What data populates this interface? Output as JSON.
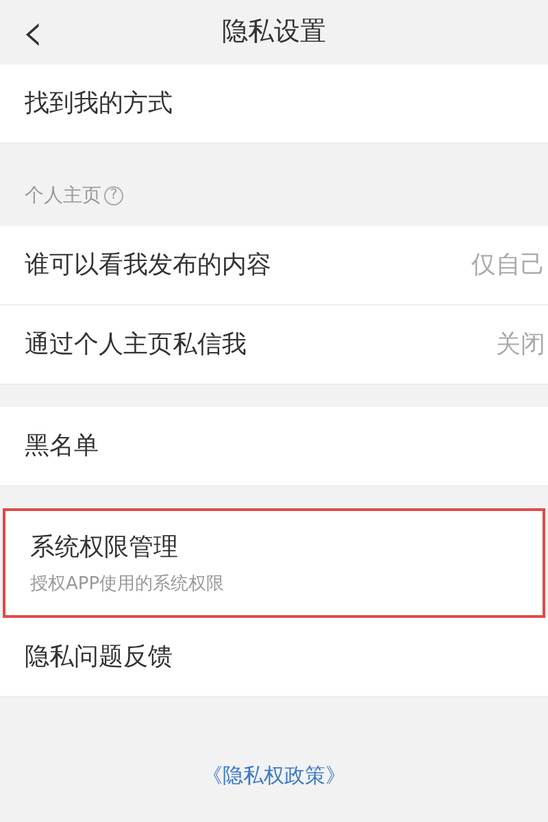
{
  "header": {
    "title": "隐私设置",
    "back": "‹"
  },
  "groups": [
    {
      "items": [
        {
          "label": "找到我的方式",
          "highlighted": false
        }
      ]
    },
    {
      "section": {
        "label": "个人主页",
        "help": "?"
      },
      "items": [
        {
          "label": "谁可以看我发布的内容",
          "value": "仅自己",
          "highlighted": false
        },
        {
          "label": "通过个人主页私信我",
          "value": "关闭",
          "highlighted": false
        }
      ]
    },
    {
      "items": [
        {
          "label": "黑名单",
          "highlighted": false
        }
      ]
    },
    {
      "items": [
        {
          "label": "系统权限管理",
          "subtitle": "授权APP使用的系统权限",
          "highlighted": true
        },
        {
          "label": "隐私问题反馈",
          "highlighted": false
        }
      ]
    }
  ],
  "footer_link": "《隐私权政策》"
}
